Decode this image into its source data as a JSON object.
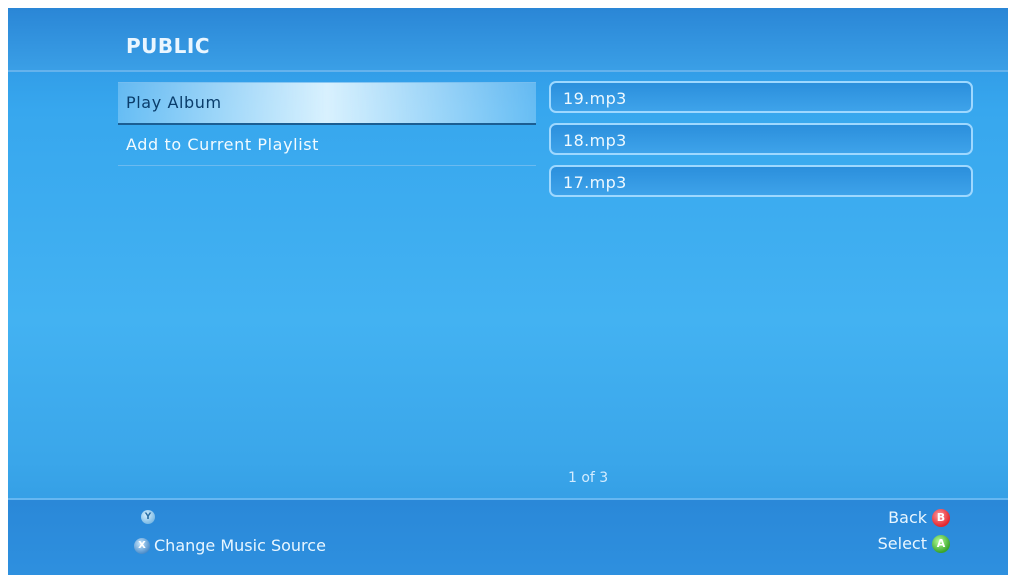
{
  "header": {
    "title": "PUBLIC"
  },
  "menu": {
    "items": [
      {
        "label": "Play Album"
      },
      {
        "label": "Add to Current Playlist"
      }
    ]
  },
  "files": [
    {
      "name": "19.mp3"
    },
    {
      "name": "18.mp3"
    },
    {
      "name": "17.mp3"
    }
  ],
  "pager": {
    "text": "1 of 3"
  },
  "footer": {
    "y_glyph": "Y",
    "x_glyph": "X",
    "change_source_label": "Change Music Source",
    "back_label": "Back",
    "b_glyph": "B",
    "select_label": "Select",
    "a_glyph": "A"
  },
  "colors": {
    "background": "#3aa6ea",
    "selected_highlight": "#e1f5ff",
    "b_button": "#e3262d",
    "a_button": "#3aa52b"
  }
}
